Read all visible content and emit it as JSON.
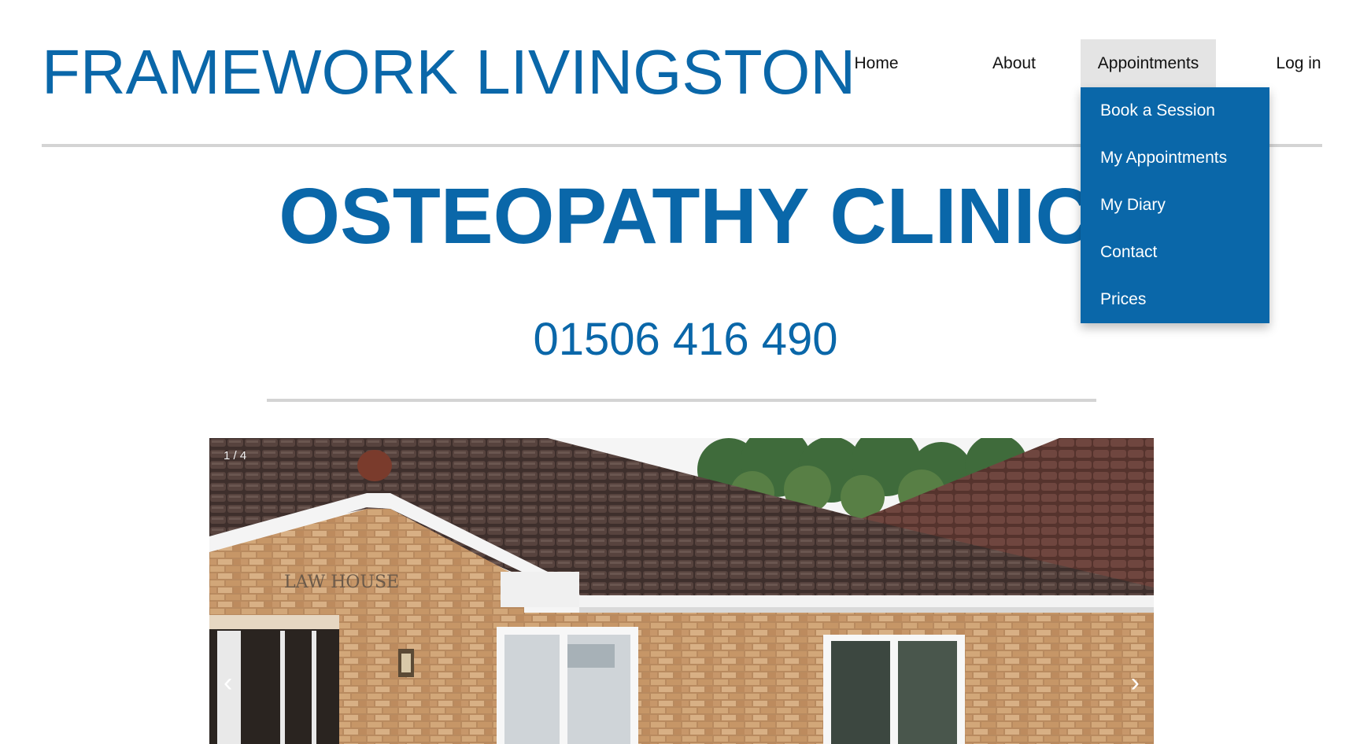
{
  "header": {
    "site_title": "FRAMEWORK LIVINGSTON"
  },
  "nav": {
    "items": [
      {
        "label": "Home"
      },
      {
        "label": "About"
      },
      {
        "label": "Appointments"
      },
      {
        "label": "Log in"
      }
    ],
    "active": "Appointments"
  },
  "dropdown": {
    "items": [
      {
        "label": "Book a Session"
      },
      {
        "label": "My Appointments"
      },
      {
        "label": "My Diary"
      },
      {
        "label": "Contact"
      },
      {
        "label": "Prices"
      }
    ]
  },
  "main": {
    "title": "OSTEOPATHY CLINIC",
    "phone": "01506 416 490"
  },
  "slideshow": {
    "counter": "1 / 4",
    "prev_icon": "‹",
    "next_icon": "›",
    "photo_sign_text": "LAW HOUSE"
  },
  "colors": {
    "brand_blue": "#0a67a9",
    "nav_active_bg": "#e4e4e4",
    "rule_gray": "#d4d4d4"
  }
}
